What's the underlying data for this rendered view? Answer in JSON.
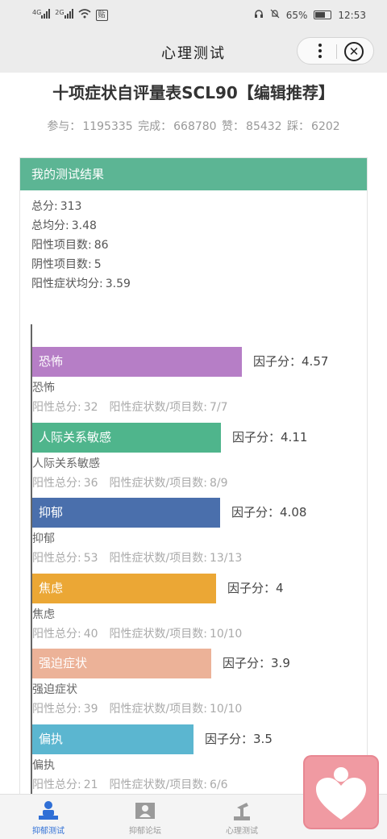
{
  "status_bar": {
    "signal1": "4G",
    "signal2": "2G",
    "badge": "贴",
    "battery": "65%",
    "time": "12:53"
  },
  "nav": {
    "title": "心理测试",
    "more_icon": "more-dots-icon",
    "close_icon": "close-circle-icon"
  },
  "header": {
    "title": "十项症状自评量表SCL90【编辑推荐】",
    "stats": [
      {
        "label": "参与：",
        "value": "1195335"
      },
      {
        "label": "完成：",
        "value": "668780"
      },
      {
        "label": "赞：",
        "value": "85432"
      },
      {
        "label": "踩：",
        "value": "6202"
      }
    ]
  },
  "result": {
    "header": "我的测试结果",
    "summary": [
      {
        "label": "总分:",
        "value": "313"
      },
      {
        "label": "总均分:",
        "value": "3.48"
      },
      {
        "label": "阳性项目数:",
        "value": "86"
      },
      {
        "label": "阴性项目数:",
        "value": "5"
      },
      {
        "label": "阳性症状均分:",
        "value": "3.59"
      }
    ],
    "score_label": "因子分：",
    "pos_total_label": "阳性总分:",
    "ratio_label": "阳性症状数/项目数:",
    "factors": [
      {
        "name": "恐怖",
        "score": "4.57",
        "score_value": 4.57,
        "positive_total": "32",
        "ratio": "7/7",
        "color": "#b67ec6"
      },
      {
        "name": "人际关系敏感",
        "score": "4.11",
        "score_value": 4.11,
        "positive_total": "36",
        "ratio": "8/9",
        "color": "#4fb58c"
      },
      {
        "name": "抑郁",
        "score": "4.08",
        "score_value": 4.08,
        "positive_total": "53",
        "ratio": "13/13",
        "color": "#4a6fac"
      },
      {
        "name": "焦虑",
        "score": "4",
        "score_value": 4,
        "positive_total": "40",
        "ratio": "10/10",
        "color": "#eba735"
      },
      {
        "name": "强迫症状",
        "score": "3.9",
        "score_value": 3.9,
        "positive_total": "39",
        "ratio": "10/10",
        "color": "#ecb298"
      },
      {
        "name": "偏执",
        "score": "3.5",
        "score_value": 3.5,
        "positive_total": "21",
        "ratio": "6/6",
        "color": "#5bb6d0"
      }
    ]
  },
  "tabbar": {
    "tabs": [
      {
        "label": "抑郁测试",
        "icon": "person-desk-icon",
        "active": true
      },
      {
        "label": "抑郁论坛",
        "icon": "forum-user-icon",
        "active": false
      },
      {
        "label": "心理测试",
        "icon": "test-lamp-icon",
        "active": false
      },
      {
        "label": "",
        "icon": "user-icon",
        "active": false
      }
    ]
  },
  "floating_button": {
    "icon": "heart-person-icon"
  }
}
